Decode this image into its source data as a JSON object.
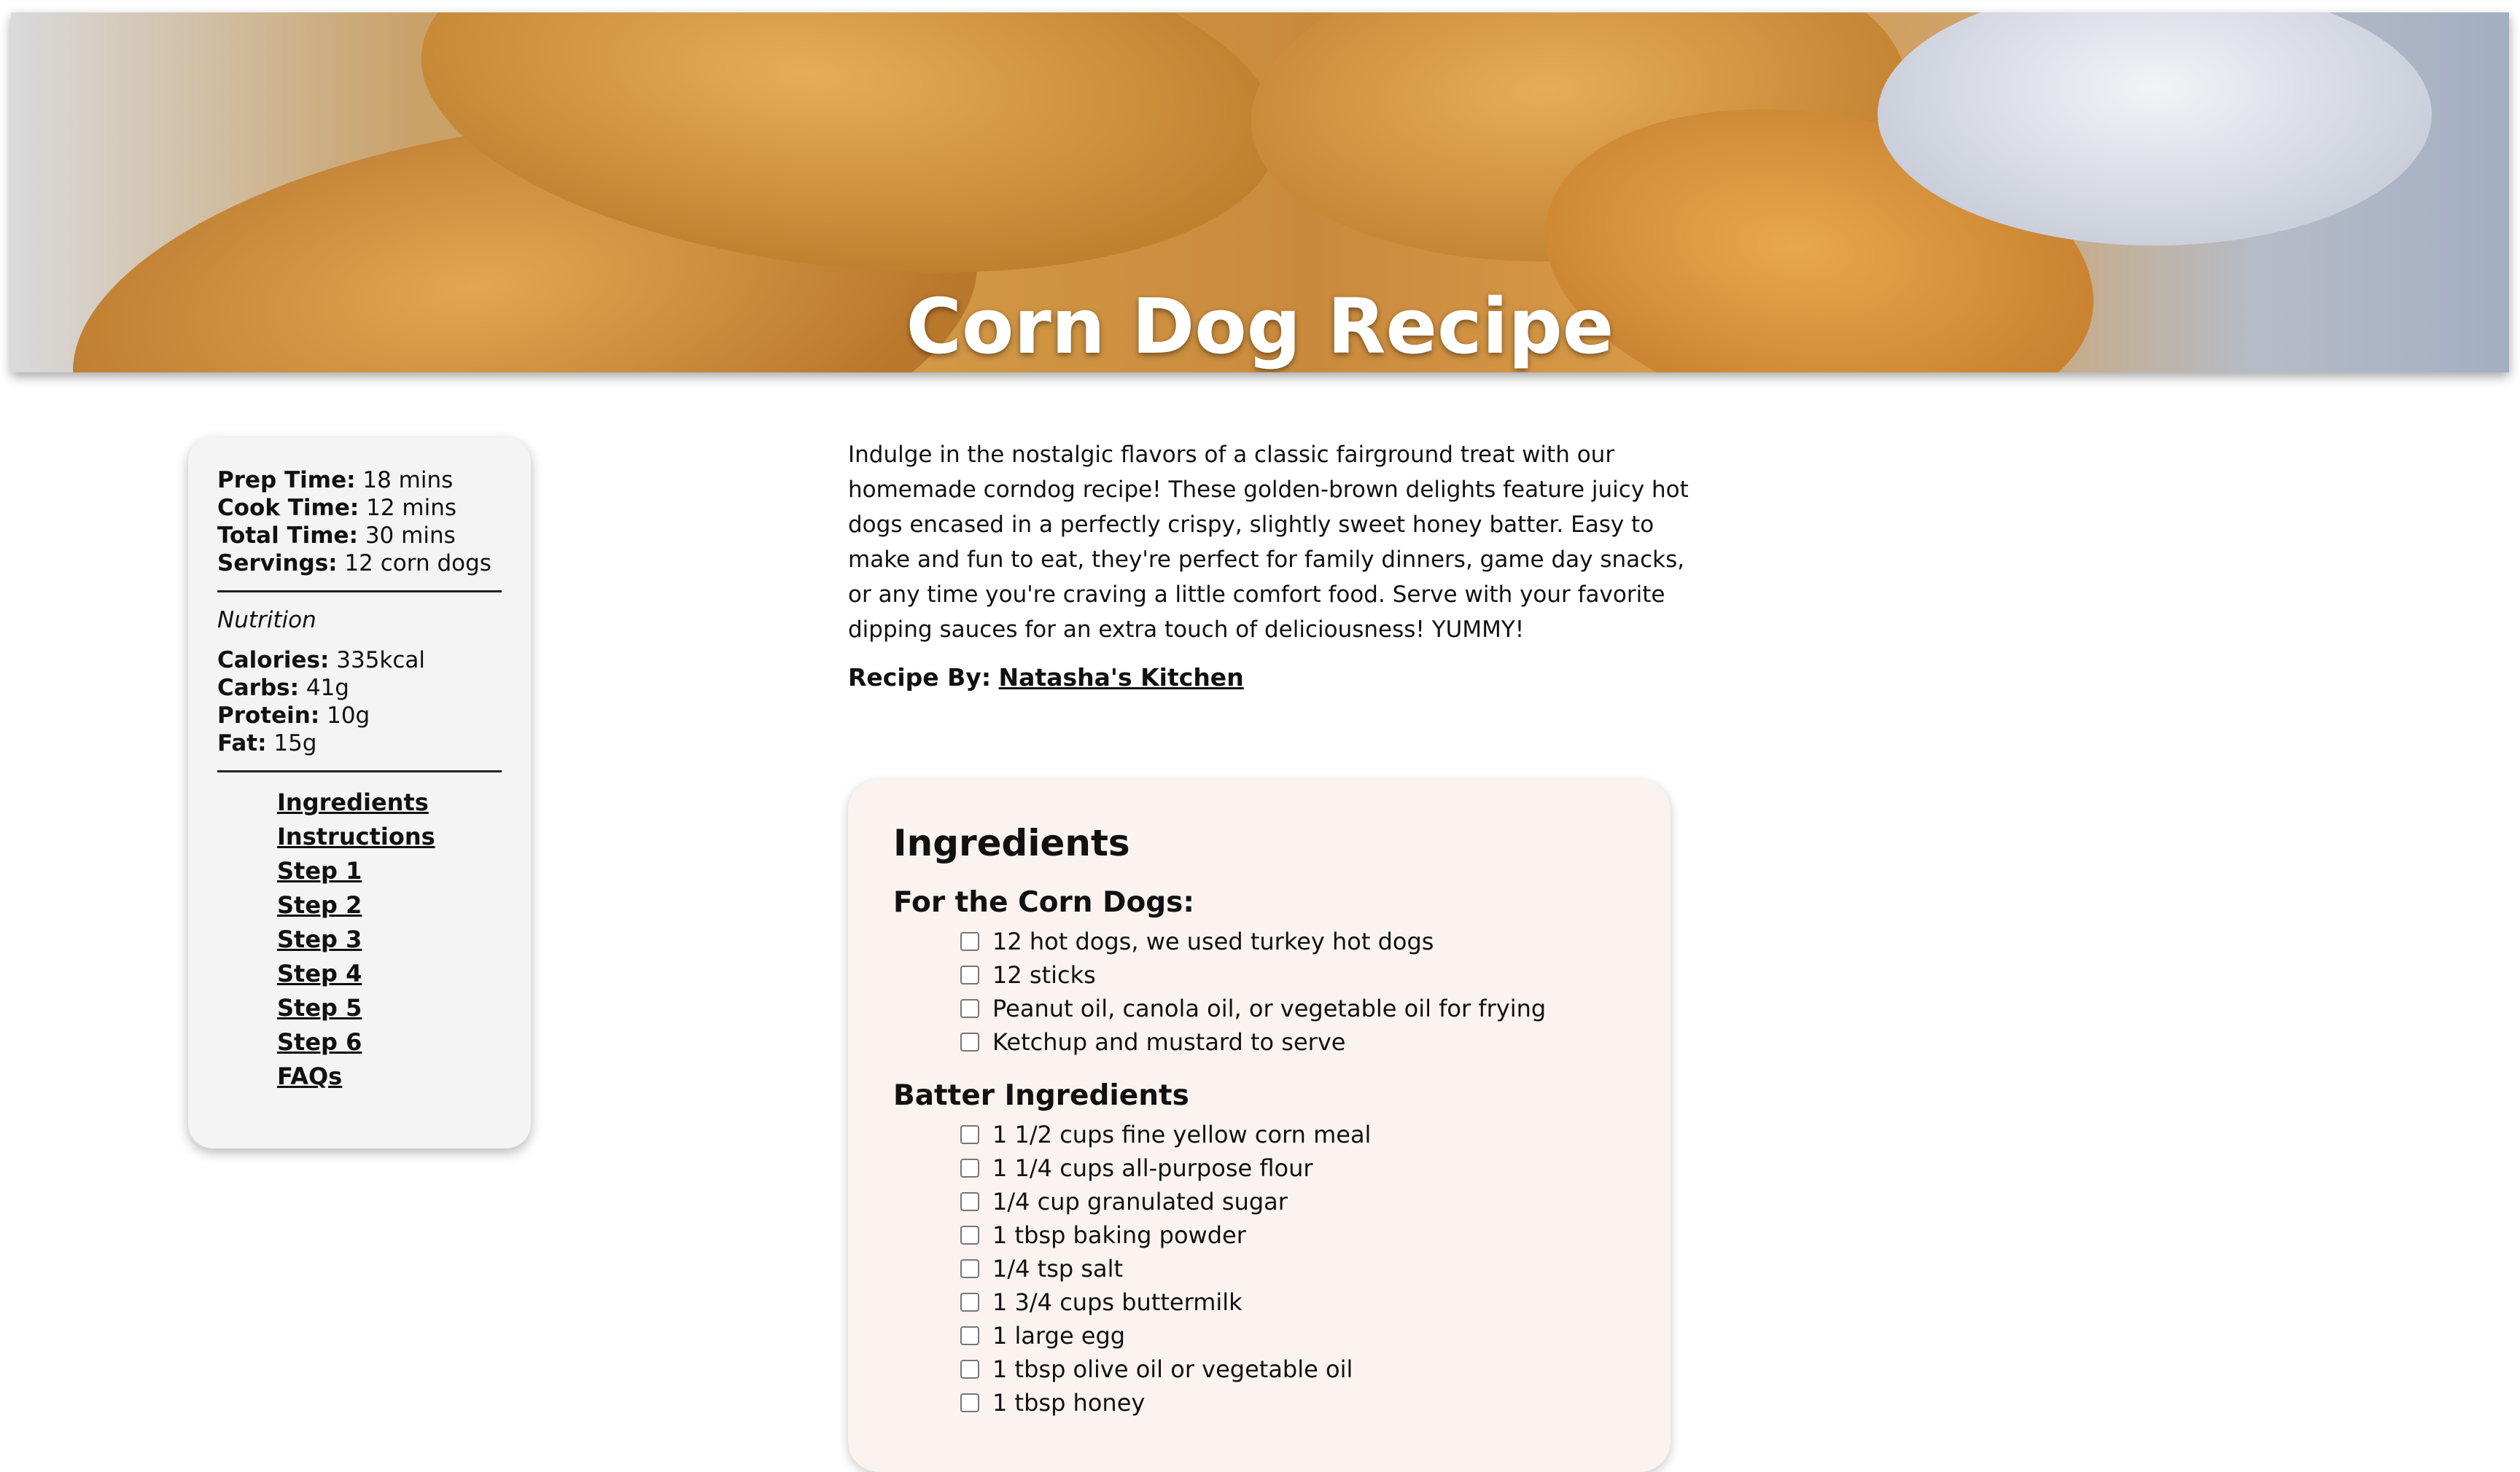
{
  "hero": {
    "title": "Corn Dog Recipe"
  },
  "sidebar": {
    "times": [
      {
        "label": "Prep Time:",
        "value": "18 mins"
      },
      {
        "label": "Cook Time:",
        "value": "12 mins"
      },
      {
        "label": "Total Time:",
        "value": "30 mins"
      },
      {
        "label": "Servings:",
        "value": "12 corn dogs"
      }
    ],
    "nutrition_heading": "Nutrition",
    "nutrition": [
      {
        "label": "Calories:",
        "value": "335kcal"
      },
      {
        "label": "Carbs:",
        "value": "41g"
      },
      {
        "label": "Protein:",
        "value": "10g"
      },
      {
        "label": "Fat:",
        "value": "15g"
      }
    ],
    "toc": [
      "Ingredients",
      "Instructions",
      "Step 1",
      "Step 2",
      "Step 3",
      "Step 4",
      "Step 5",
      "Step 6",
      "FAQs"
    ]
  },
  "main": {
    "intro": "Indulge in the nostalgic flavors of a classic fairground treat with our homemade corndog recipe! These golden-brown delights feature juicy hot dogs encased in a perfectly crispy, slightly sweet honey batter. Easy to make and fun to eat, they're perfect for family dinners, game day snacks, or any time you're craving a little comfort food. Serve with your favorite dipping sauces for an extra touch of deliciousness! YUMMY!",
    "recipe_by_label": "Recipe By:",
    "recipe_by_link": "Natasha's Kitchen"
  },
  "ingredients": {
    "title": "Ingredients",
    "sections": [
      {
        "heading": "For the Corn Dogs:",
        "items": [
          "12 hot dogs, we used turkey hot dogs",
          "12 sticks",
          "Peanut oil, canola oil, or vegetable oil for frying",
          "Ketchup and mustard to serve"
        ]
      },
      {
        "heading": "Batter Ingredients",
        "items": [
          "1 1/2 cups fine yellow corn meal",
          "1 1/4 cups all-purpose flour",
          "1/4 cup granulated sugar",
          "1 tbsp baking powder",
          "1/4 tsp salt",
          "1 3/4 cups buttermilk",
          "1 large egg",
          "1 tbsp olive oil or vegetable oil",
          "1 tbsp honey"
        ]
      }
    ]
  }
}
